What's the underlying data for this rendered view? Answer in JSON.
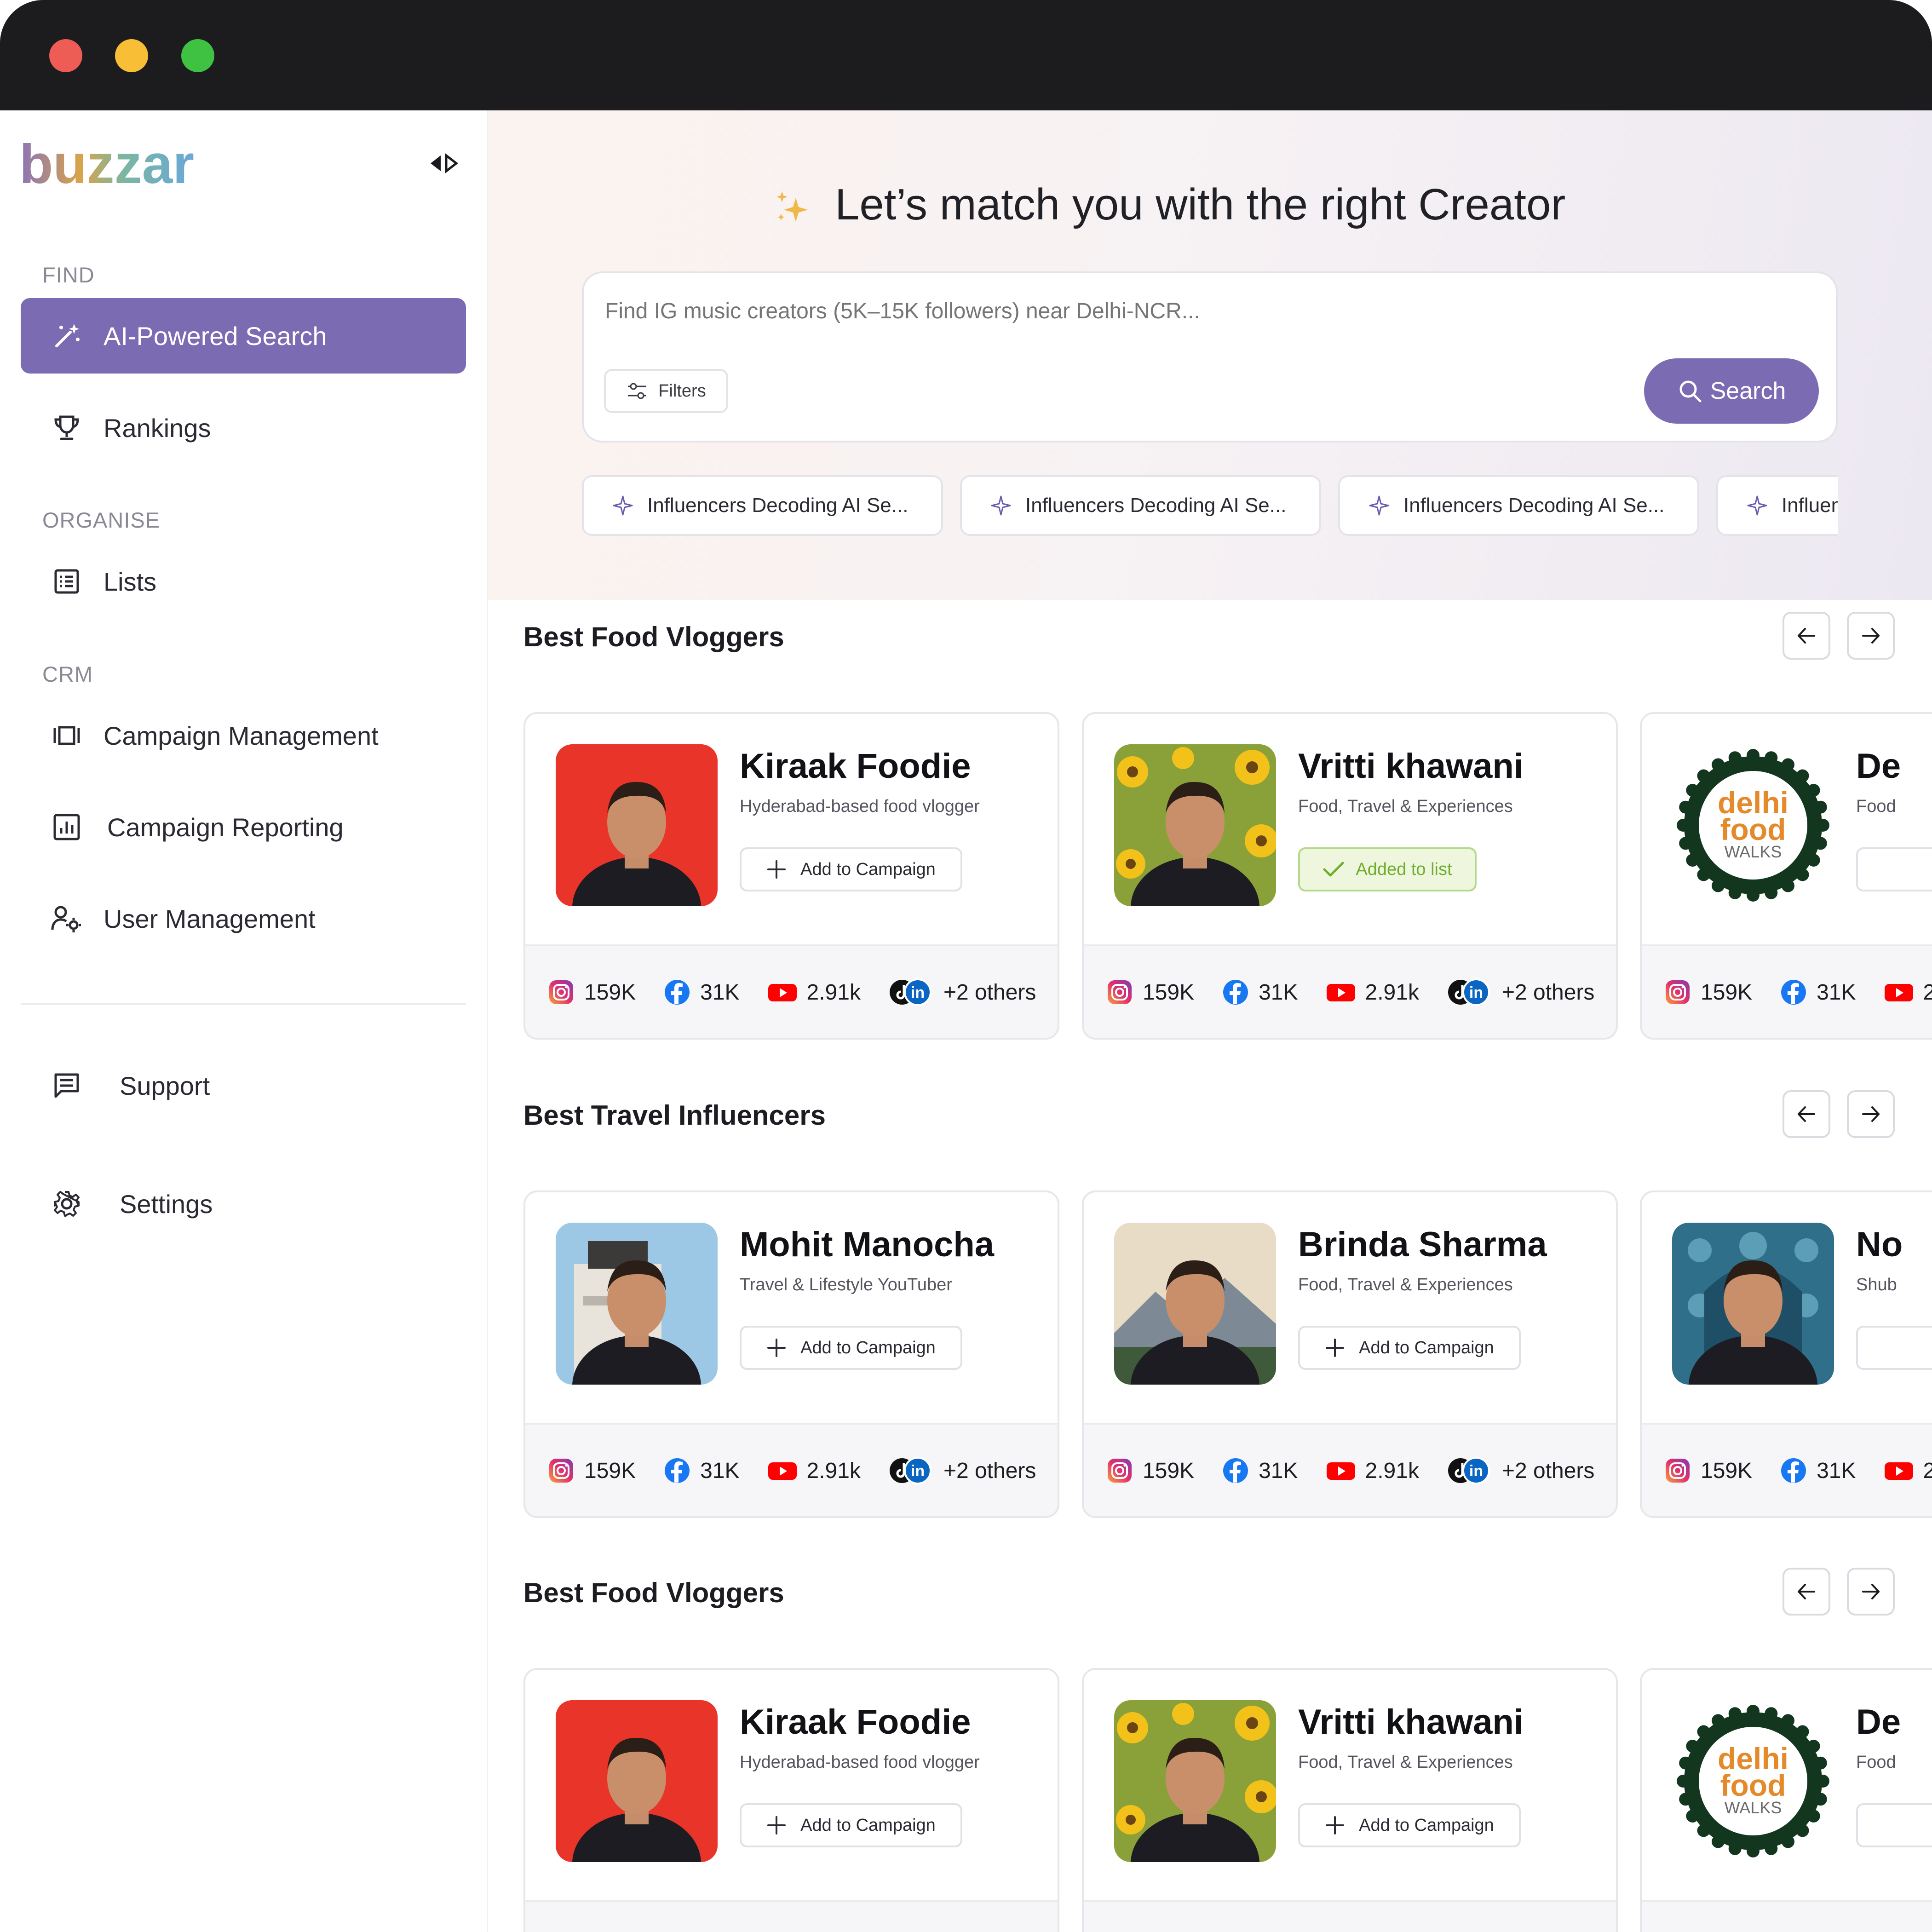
{
  "window": {
    "colors": {
      "close": "#ee5c56",
      "minimize": "#f7be36",
      "maximize": "#3fc142"
    }
  },
  "brand": {
    "logo_text": "buzzar"
  },
  "sidebar": {
    "sections": [
      {
        "label": "FIND"
      },
      {
        "label": "ORGANISE"
      },
      {
        "label": "CRM"
      }
    ],
    "items": [
      {
        "label": "AI-Powered Search",
        "icon": "magic-wand-icon",
        "active": true
      },
      {
        "label": "Rankings",
        "icon": "trophy-icon"
      },
      {
        "label": "Lists",
        "icon": "list-icon"
      },
      {
        "label": "Campaign Management",
        "icon": "carousel-icon"
      },
      {
        "label": "Campaign Reporting",
        "icon": "bar-chart-icon"
      },
      {
        "label": "User Management",
        "icon": "user-gear-icon"
      },
      {
        "label": "Support",
        "icon": "message-icon"
      },
      {
        "label": "Settings",
        "icon": "gear-icon"
      }
    ]
  },
  "hero": {
    "title": "Let’s match you with the right Creator",
    "search": {
      "placeholder": "Find IG music creators (5K–15K followers) near Delhi-NCR...",
      "value": ""
    },
    "filters_label": "Filters",
    "search_label": "Search",
    "suggestions": [
      "Influencers Decoding AI Se...",
      "Influencers Decoding AI Se...",
      "Influencers Decoding AI Se...",
      "Influencers Decoding AI Se..."
    ]
  },
  "rows": [
    {
      "title": "Best Food Vloggers",
      "cards": [
        {
          "name": "Kiraak Foodie",
          "desc": "Hyderabad-based food vlogger",
          "action": "Add to Campaign",
          "added": false
        },
        {
          "name": "Vritti khawani",
          "desc": "Food, Travel & Experiences",
          "action": "Added to list",
          "added": true
        },
        {
          "name": "De",
          "desc": "Food",
          "action": "",
          "added": false
        }
      ]
    },
    {
      "title": "Best Travel Influencers",
      "cards": [
        {
          "name": "Mohit Manocha",
          "desc": "Travel & Lifestyle YouTuber",
          "action": "Add to Campaign",
          "added": false
        },
        {
          "name": "Brinda Sharma",
          "desc": "Food, Travel & Experiences",
          "action": "Add to Campaign",
          "added": false
        },
        {
          "name": "No",
          "desc": "Shub",
          "action": "",
          "added": false
        }
      ]
    },
    {
      "title": "Best Food Vloggers",
      "cards": [
        {
          "name": "Kiraak Foodie",
          "desc": "Hyderabad-based food vlogger",
          "action": "Add to Campaign",
          "added": false
        },
        {
          "name": "Vritti khawani",
          "desc": "Food, Travel & Experiences",
          "action": "Add to Campaign",
          "added": false
        },
        {
          "name": "De",
          "desc": "Food",
          "action": "",
          "added": false
        }
      ]
    }
  ],
  "stats": {
    "instagram": "159K",
    "facebook": "31K",
    "youtube": "2.91k",
    "others": "+2 others"
  },
  "logo_art": {
    "line1": "delhi",
    "line2": "food",
    "line3": "WALKS"
  },
  "colors": {
    "accent": "#7b6bb3",
    "added_green": "#6fae2d"
  }
}
